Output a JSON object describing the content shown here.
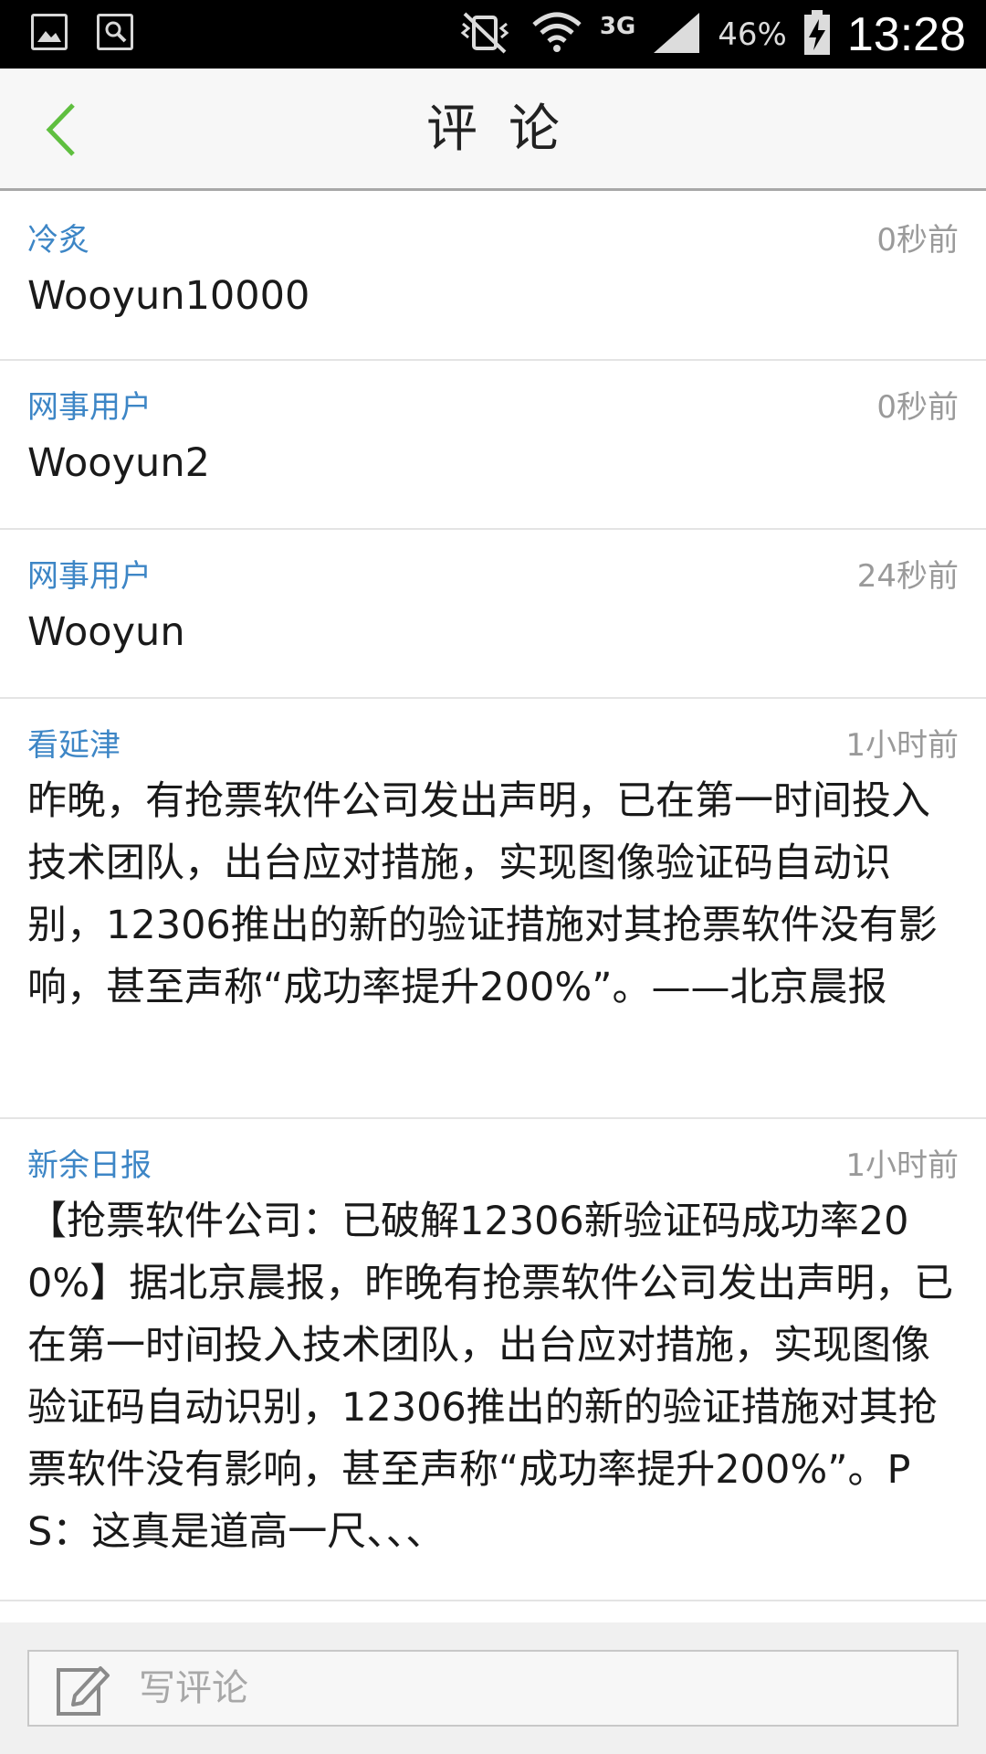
{
  "status_bar": {
    "network": "3G",
    "battery": "46%",
    "time": "13:28"
  },
  "header": {
    "title": "评论"
  },
  "comments": [
    {
      "author": "冷炙",
      "time": "0秒前",
      "text": "Wooyun10000"
    },
    {
      "author": "网事用户",
      "time": "0秒前",
      "text": "Wooyun2"
    },
    {
      "author": "网事用户",
      "time": "24秒前",
      "text": "Wooyun"
    },
    {
      "author": "看延津",
      "time": "1小时前",
      "text": "昨晚，有抢票软件公司发出声明，已在第一时间投入技术团队，出台应对措施，实现图像验证码自动识别，12306推出的新的验证措施对其抢票软件没有影响，甚至声称“成功率提升200%”。——北京晨报"
    },
    {
      "author": "新余日报",
      "time": "1小时前",
      "text": "【抢票软件公司：已破解12306新验证码成功率200%】据北京晨报，昨晚有抢票软件公司发出声明，已在第一时间投入技术团队，出台应对措施，实现图像验证码自动识别，12306推出的新的验证措施对其抢票软件没有影响，甚至声称“成功率提升200%”。PS：这真是道高一尺、、、"
    }
  ],
  "bottom_bar": {
    "placeholder": "写评论"
  },
  "colors": {
    "accent_green": "#5fbf3f",
    "author_blue": "#3d86c6"
  }
}
